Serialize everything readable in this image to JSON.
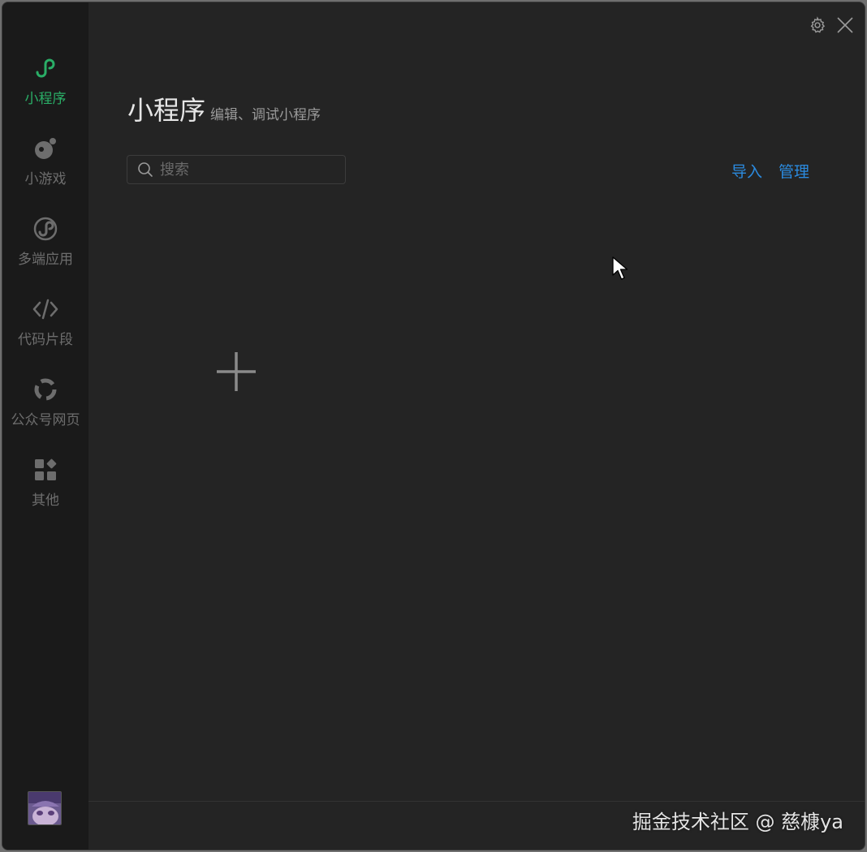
{
  "sidebar": {
    "items": [
      {
        "label": "小程序",
        "icon": "mini-program-icon",
        "active": true
      },
      {
        "label": "小游戏",
        "icon": "mini-game-icon",
        "active": false
      },
      {
        "label": "多端应用",
        "icon": "multi-platform-icon",
        "active": false
      },
      {
        "label": "代码片段",
        "icon": "code-icon",
        "active": false
      },
      {
        "label": "公众号网页",
        "icon": "official-account-icon",
        "active": false
      },
      {
        "label": "其他",
        "icon": "other-icon",
        "active": false
      }
    ],
    "avatar": "avatar"
  },
  "header": {
    "title": "小程序",
    "subtitle": "编辑、调试小程序"
  },
  "search": {
    "placeholder": "搜索",
    "value": ""
  },
  "actions": {
    "import_label": "导入",
    "manage_label": "管理"
  },
  "watermark": "掘金技术社区 @ 慈槺ya",
  "colors": {
    "accent_green": "#2aae67",
    "link_blue": "#2b8be0",
    "background": "#242424",
    "sidebar": "#1a1a1a"
  }
}
